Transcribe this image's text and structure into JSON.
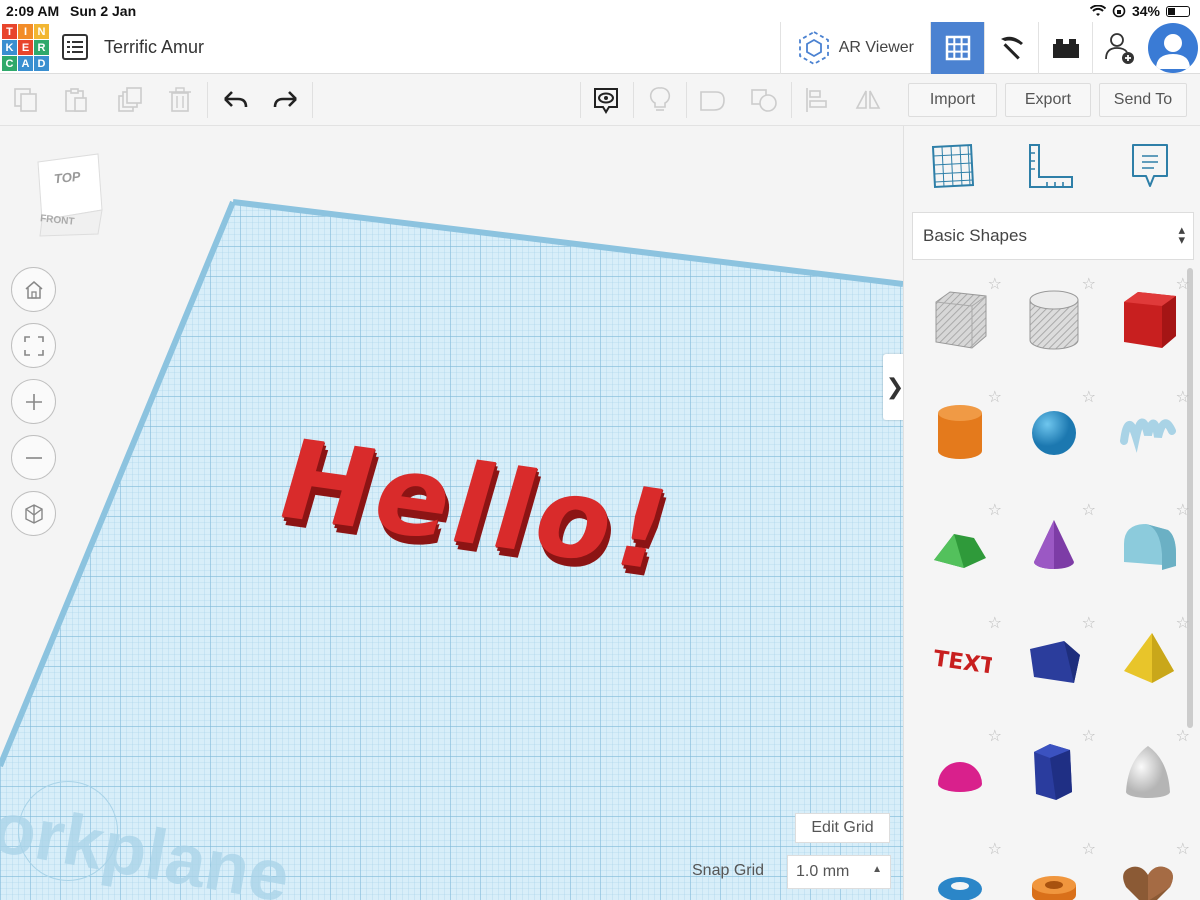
{
  "status_bar": {
    "time": "2:09 AM",
    "date": "Sun 2 Jan",
    "battery": "34%"
  },
  "header": {
    "logo_letters": [
      "T",
      "I",
      "N",
      "K",
      "E",
      "R",
      "C",
      "A",
      "D"
    ],
    "logo_colors": [
      "#e8452c",
      "#f28c28",
      "#f2b632",
      "#3a8fd0",
      "#e8452c",
      "#2fa96b",
      "#2fa96b",
      "#3a8fd0",
      "#3a8fd0"
    ],
    "title": "Terrific Amur",
    "ar_viewer_label": "AR Viewer"
  },
  "toolbar": {
    "import_label": "Import",
    "export_label": "Export",
    "send_to_label": "Send To"
  },
  "workspace": {
    "cube_top": "TOP",
    "cube_front": "FRONT",
    "model_text": "Hello!",
    "model_color": "#d92b2b",
    "workplane_label": "orkplane",
    "edit_grid_label": "Edit Grid",
    "snap_grid_label": "Snap Grid",
    "snap_grid_value": "1.0 mm"
  },
  "panel": {
    "category": "Basic Shapes",
    "shapes": [
      {
        "name": "box-hole"
      },
      {
        "name": "cylinder-hole"
      },
      {
        "name": "box"
      },
      {
        "name": "cylinder"
      },
      {
        "name": "sphere"
      },
      {
        "name": "scribble"
      },
      {
        "name": "roof"
      },
      {
        "name": "cone"
      },
      {
        "name": "round-roof"
      },
      {
        "name": "text"
      },
      {
        "name": "wedge"
      },
      {
        "name": "pyramid"
      },
      {
        "name": "half-sphere"
      },
      {
        "name": "polygon"
      },
      {
        "name": "paraboloid"
      },
      {
        "name": "torus"
      },
      {
        "name": "tube"
      },
      {
        "name": "heart"
      }
    ],
    "shape_text_label": "TEXT"
  }
}
